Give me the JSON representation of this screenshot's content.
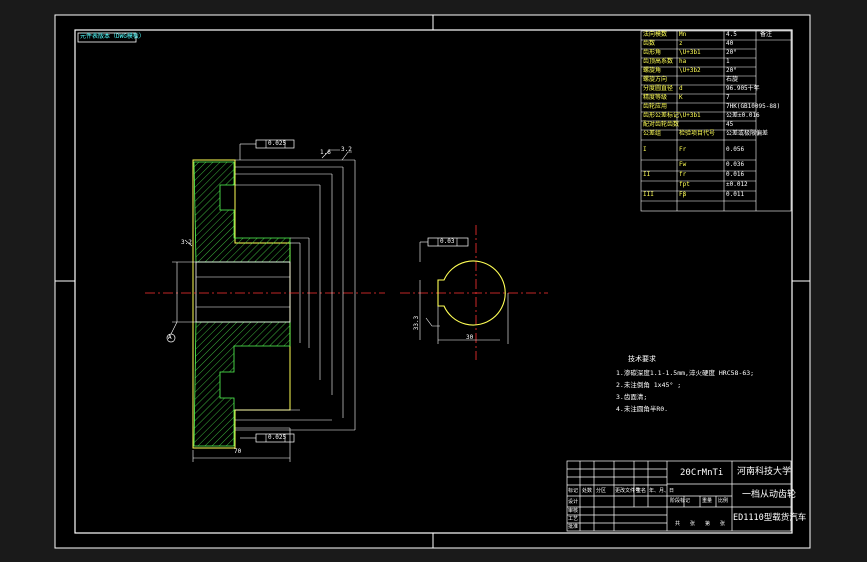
{
  "frame_label": "元件表版本（DWG模板）",
  "params_table": {
    "rows": [
      [
        "法向模数",
        "Mn",
        "4.5",
        "备注"
      ],
      [
        "齿数",
        "z",
        "40",
        ""
      ],
      [
        "齿形角",
        "\\U+3b1",
        "20°",
        ""
      ],
      [
        "齿顶高系数",
        "ha",
        "1",
        ""
      ],
      [
        "螺旋角",
        "\\U+3b2",
        "20°",
        ""
      ],
      [
        "螺旋方向",
        "",
        "右旋",
        ""
      ],
      [
        "分度圆直径",
        "d",
        "96.905十年",
        ""
      ],
      [
        "精度等级",
        "K",
        "7",
        ""
      ],
      [
        "齿轮应用",
        "",
        "7HK(GB10095-88)",
        ""
      ],
      [
        "齿形公差标记",
        "\\U+3b1",
        "公差±0.016",
        ""
      ],
      [
        "配对齿轮齿数",
        "",
        "45",
        ""
      ],
      [
        "公差组",
        "检验项目代号",
        "公差或极限偏差",
        ""
      ],
      [
        "I",
        "Fr",
        "0.056",
        ""
      ],
      [
        "",
        "Fw",
        "0.036",
        ""
      ],
      [
        "II",
        "fr",
        "0.016",
        ""
      ],
      [
        "",
        "fpt",
        "±0.012",
        ""
      ],
      [
        "III",
        "Fβ",
        "0.011",
        ""
      ]
    ]
  },
  "gear_view": {
    "top_callout": "0.025",
    "bottom_callout": "0.025",
    "bottom_dimension": "70",
    "roughness_1": "1.6",
    "roughness_2": "3.2",
    "roughness_3": "3.2",
    "hub_label": "A"
  },
  "end_view": {
    "callout": "0.03",
    "keyway_dim": "33.3",
    "bore_dim": "30"
  },
  "tech_notes": {
    "heading": "技术要求",
    "lines": [
      "1.渗碳深度1.1-1.5mm,淬火硬度 HRC58-63;",
      "2.未注倒角 1x45° ;",
      "3.齿面清;",
      "4.未注圆角半R0."
    ]
  },
  "title_block": {
    "material": "20CrMnTi",
    "university": "河南科技大学",
    "part_name": "一档从动齿轮",
    "project": "ED1110型载货汽车",
    "cells": [
      "标记",
      "处数",
      "分区",
      "更改文件号",
      "签名",
      "年、月、日"
    ],
    "stage_labels": [
      "阶段标记",
      "重量",
      "比例"
    ],
    "bottom_labels": [
      "共",
      "张",
      "第",
      "张"
    ],
    "left_labels": [
      "设计",
      "审核",
      "工艺",
      "批准"
    ]
  },
  "colors": {
    "background_outer": "#1a1a1a",
    "sheet": "#000000",
    "lines": "#ffffff",
    "yellow": "#ffff55",
    "green": "#55ff55",
    "red": "#ff3333",
    "cyan": "#55ffff"
  }
}
